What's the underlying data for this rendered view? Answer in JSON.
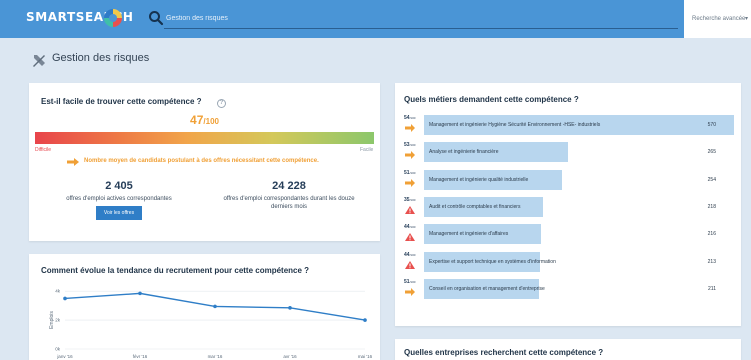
{
  "header": {
    "logo_text": "SMARTSEARCH",
    "search_placeholder": "Gestion des risques",
    "advanced_search_label": "Recherche avancée",
    "accent_color": "#4a95d6"
  },
  "page": {
    "title": "Gestion des risques",
    "icon": "tools-icon"
  },
  "difficulty_card": {
    "title": "Est-il facile de trouver cette compétence ?",
    "help_icon": "?",
    "score": "47",
    "score_total": "/100",
    "score_fraction": 0.47,
    "gauge_min_label": "Difficile",
    "gauge_max_label": "Facile",
    "candidates_text": "Nombre moyen de candidats postulant à des offres nécessitant cette compétence.",
    "stat1_value": "2 405",
    "stat1_label": "offres d'emploi actives correspondantes",
    "stat2_value": "24 228",
    "stat2_label": "offres d'emploi correspondantes durant les douze derniers mois",
    "button_label": "Voir les offres"
  },
  "jobs_card": {
    "title": "Quels métiers demandent cette compétence ?",
    "rank_suffix": "/100",
    "rows": [
      {
        "rank": "54",
        "indicator": "arrow",
        "label": "Management et ingénierie Hygiène Sécurité Environnement -HSE- industriels",
        "count": "570",
        "value": 570
      },
      {
        "rank": "53",
        "indicator": "arrow",
        "label": "Analyse et ingénierie financière",
        "count": "265",
        "value": 265
      },
      {
        "rank": "51",
        "indicator": "arrow",
        "label": "Management et ingénierie qualité industrielle",
        "count": "254",
        "value": 254
      },
      {
        "rank": "35",
        "indicator": "warning",
        "label": "Audit et contrôle comptables et financiers",
        "count": "218",
        "value": 218
      },
      {
        "rank": "44",
        "indicator": "warning",
        "label": "Management et ingénierie d'affaires",
        "count": "216",
        "value": 216
      },
      {
        "rank": "44",
        "indicator": "warning",
        "label": "Expertise et support technique en systèmes d'information",
        "count": "213",
        "value": 213
      },
      {
        "rank": "51",
        "indicator": "arrow",
        "label": "Conseil en organisation et management d'entreprise",
        "count": "211",
        "value": 211
      }
    ]
  },
  "trend_card": {
    "title": "Comment évolue la tendance du recrutement pour cette compétence ?"
  },
  "companies_card": {
    "title": "Quelles entreprises recherchent cette compétence ?"
  },
  "chart_data": {
    "type": "line",
    "title": "",
    "xlabel": "",
    "ylabel": "Emplois",
    "categories": [
      "janv '16",
      "févr '16",
      "mar '16",
      "avr '16",
      "mai '16"
    ],
    "y_tick_labels": [
      "0k",
      "2k",
      "4k"
    ],
    "ylim": [
      0,
      4500
    ],
    "grid": true,
    "series": [
      {
        "values": [
          3500,
          3850,
          2950,
          2850,
          2000
        ]
      }
    ],
    "colors": {
      "line": "#2f7ec7",
      "point": "#2f7ec7",
      "grid": "#e3e8ee"
    }
  }
}
